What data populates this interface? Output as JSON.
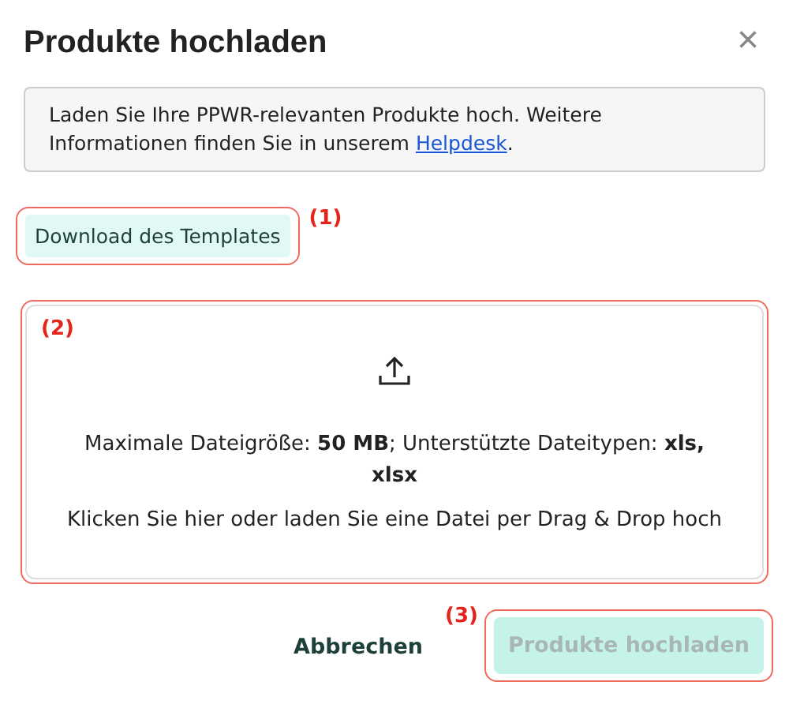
{
  "dialog": {
    "title": "Produkte hochladen",
    "close": "×"
  },
  "info": {
    "text": "Laden Sie Ihre PPWR-relevanten Produkte hoch. Weitere Informationen finden Sie in unserem ",
    "link": "Helpdesk",
    "end": "."
  },
  "download_button": {
    "label": "Download des Templates",
    "annotation": "(1)"
  },
  "dropzone": {
    "annotation": "(2)",
    "limits": "Maximale Dateigröße: **50 MB**; Unterstützte Dateitypen: **xls, xlsx**",
    "hint": "Klicken Sie hier oder laden Sie eine Datei per Drag & Drop hoch"
  },
  "footer": {
    "cancel": "Abbrechen",
    "submit": {
      "label": "Produkte hochladen",
      "disabled": true,
      "annotation": "(3)"
    }
  }
}
